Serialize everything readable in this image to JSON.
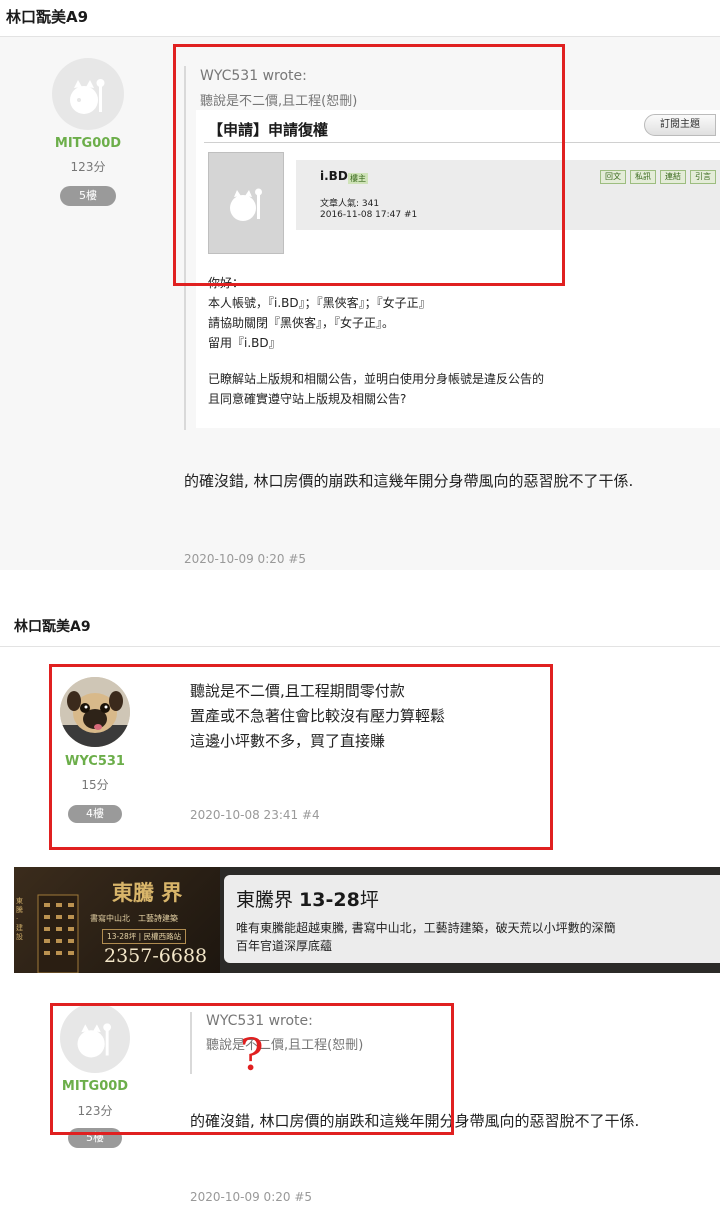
{
  "section1": {
    "board_title": "林口翫美A9",
    "user": {
      "name": "MITG00D",
      "score": "123分",
      "floor": "5樓"
    },
    "quote": {
      "author": "WYC531 wrote:",
      "text": "聽說是不二價,且工程(恕刪)",
      "embedded": {
        "title": "【申請】申請復權",
        "subscribe_label": "訂閱主題",
        "poster": "i.BD",
        "poster_badge": "樓主",
        "popularity": "文章人氣: 341",
        "datetime": "2016-11-08 17:47  #1",
        "actions": [
          "回文",
          "私訊",
          "連結",
          "引言"
        ],
        "letter": [
          "你好：",
          "本人帳號，『i.BD』；『黑俠客』；『女子正』",
          "請協助關閉『黑俠客』，『女子正』。",
          "留用『i.BD』",
          "",
          "已瞭解站上版規和相關公告，並明白使用分身帳號是違反公告的",
          "且同意確實遵守站上版規及相關公告?"
        ]
      }
    },
    "post_text": "的確沒錯, 林口房價的崩跌和這幾年開分身帶風向的惡習脫不了干係.",
    "meta": "2020-10-09 0:20 #5"
  },
  "section2": {
    "board_title": "林口翫美A9",
    "post4": {
      "user": {
        "name": "WYC531",
        "score": "15分",
        "floor": "4樓"
      },
      "lines": [
        "聽說是不二價,且工程期間零付款",
        "置產或不急著住會比較沒有壓力算輕鬆",
        "這邊小坪數不多，買了直接賺"
      ],
      "meta": "2020-10-08 23:41 #4"
    },
    "ad": {
      "brand": "東騰 界",
      "tagline": "書寫中山北　工藝詩建築",
      "sub_tagline": "13-28坪 | 民權西路站",
      "phone": "2357-6688",
      "side_text": "東騰 · 建設",
      "headline_prefix": "東騰界 ",
      "headline_bold": "13-28",
      "headline_suffix": "坪",
      "desc_1": "唯有東騰能超越東騰, 書寫中山北，工藝詩建築，破天荒以小坪數的深簡",
      "desc_2": "百年官道深厚底蘊"
    },
    "post5": {
      "user": {
        "name": "MITG00D",
        "score": "123分",
        "floor": "5樓"
      },
      "quote_author": "WYC531 wrote:",
      "quote_text": "聽說是不二價,且工程(恕刪)",
      "question_mark": "?",
      "post_text": "的確沒錯, 林口房價的崩跌和這幾年開分身帶風向的惡習脫不了干係.",
      "meta": "2020-10-09 0:20 #5"
    }
  },
  "colors": {
    "username": "#6cae4a",
    "highlight_box": "#e02020",
    "badge": "#9a9a9a",
    "ad_gold": "#d8b56a"
  }
}
